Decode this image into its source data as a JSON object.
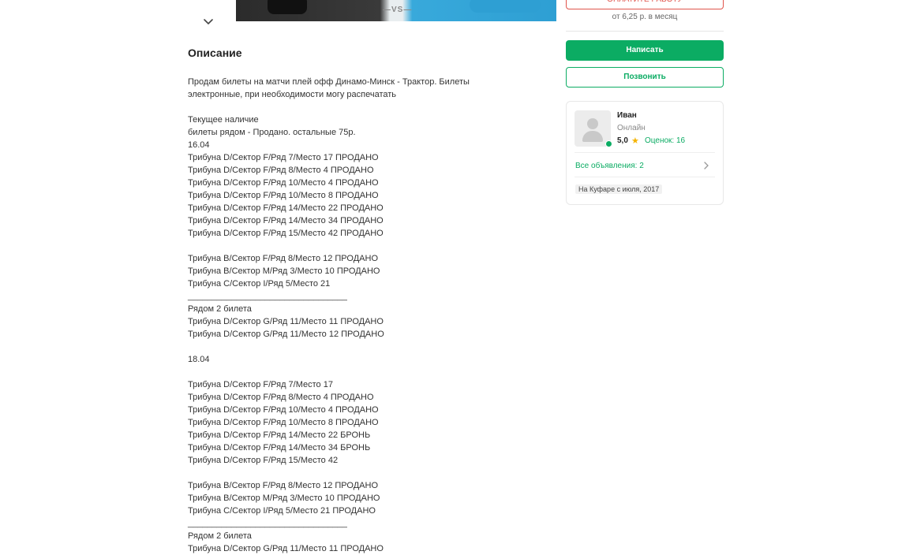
{
  "header": {
    "banner_vs": "—VS—"
  },
  "description": {
    "title": "Описание",
    "body": "Продам билеты на матчи плей офф Динамо-Минск - Трактор. Билеты\nэлектронные, при необходимости могу распечатать\n\nТекущее наличие\nбилеты рядом - Продано. остальные 75р.\n16.04\nТрибуна D/Сектор F/Ряд 7/Место 17 ПРОДАНО\nТрибуна D/Сектор F/Ряд 8/Место 4 ПРОДАНО\nТрибуна D/Сектор F/Ряд 10/Место 4 ПРОДАНО\nТрибуна D/Сектор F/Ряд 10/Место 8 ПРОДАНО\nТрибуна D/Сектор F/Ряд 14/Место 22 ПРОДАНО\nТрибуна D/Сектор F/Ряд 14/Место 34 ПРОДАНО\nТрибуна D/Сектор F/Ряд 15/Место 42 ПРОДАНО\n\nТрибуна B/Сектор F/Ряд 8/Место 12 ПРОДАНО\nТрибуна B/Сектор M/Ряд 3/Место 10 ПРОДАНО\nТрибуна C/Сектор I/Ряд 5/Место 21\n_________________________________\nРядом 2 билета\nТрибуна D/Сектор G/Ряд 11/Место 11 ПРОДАНО\nТрибуна D/Сектор G/Ряд 11/Место 12 ПРОДАНО\n\n18.04\n\nТрибуна D/Сектор F/Ряд 7/Место 17\nТрибуна D/Сектор F/Ряд 8/Место 4 ПРОДАНО\nТрибуна D/Сектор F/Ряд 10/Место 4 ПРОДАНО\nТрибуна D/Сектор F/Ряд 10/Место 8 ПРОДАНО\nТрибуна D/Сектор F/Ряд 14/Место 22 БРОНЬ\nТрибуна D/Сектор F/Ряд 14/Место 34 БРОНЬ\nТрибуна D/Сектор F/Ряд 15/Место 42\n\nТрибуна B/Сектор F/Ряд 8/Место 12 ПРОДАНО\nТрибуна B/Сектор M/Ряд 3/Место 10 ПРОДАНО\nТрибуна C/Сектор I/Ряд 5/Место 21 ПРОДАНО\n_________________________________\nРядом 2 билета\nТрибуна D/Сектор G/Ряд 11/Место 11 ПРОДАНО"
  },
  "sidebar": {
    "top_button_label": "ОПЛАТИТЕ РАБОТУ",
    "price_note": "от 6,25 р. в месяц",
    "write_button": "Написать",
    "call_button": "Позвонить",
    "seller": {
      "name": "Иван",
      "status": "Онлайн",
      "rating": "5,0",
      "reviews": "Оценок: 16",
      "all_ads": "Все объявления: 2",
      "since": "На Куфаре с июля, 2017"
    }
  },
  "colors": {
    "accent_green": "#0bac63",
    "accent_red": "#e0544b",
    "star": "#f5b301"
  },
  "icons": [
    "chevron-down-icon",
    "avatar-placeholder-icon",
    "star-icon",
    "chevron-right-icon"
  ]
}
